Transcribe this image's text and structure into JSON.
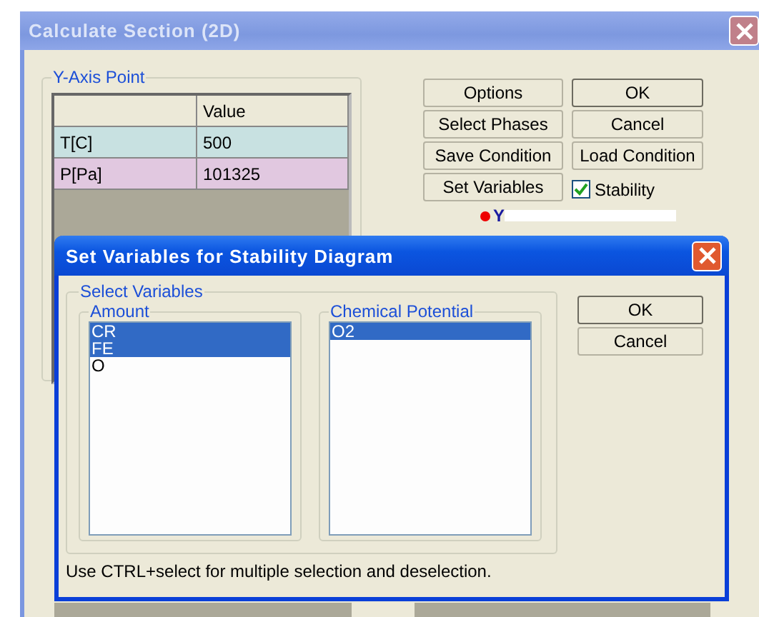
{
  "window": {
    "title": "Calculate Section (2D)"
  },
  "y_axis_point": {
    "title": "Y-Axis Point",
    "column_header": "Value",
    "rows": [
      {
        "name": "T[C]",
        "value": "500",
        "color": "#c8e1e1"
      },
      {
        "name": "P[Pa]",
        "value": "101325",
        "color": "#e1c8e0"
      }
    ]
  },
  "buttons": [
    {
      "label": "Options",
      "default": false
    },
    {
      "label": "OK",
      "default": true
    },
    {
      "label": "Select Phases",
      "default": false
    },
    {
      "label": "Cancel",
      "default": false
    },
    {
      "label": "Save Condition",
      "default": false
    },
    {
      "label": "Load Condition",
      "default": false
    },
    {
      "label": "Set Variables",
      "default": false
    }
  ],
  "stability": {
    "label": "Stability",
    "checked": true
  },
  "y_field": {
    "label": "Y"
  },
  "dialog": {
    "title": "Set Variables for Stability Diagram",
    "group": "Select Variables",
    "lists": [
      {
        "title": "Amount",
        "items": [
          {
            "label": "CR",
            "selected": true
          },
          {
            "label": "FE",
            "selected": true
          },
          {
            "label": "O",
            "selected": false
          }
        ]
      },
      {
        "title": "Chemical Potential",
        "items": [
          {
            "label": "O2",
            "selected": true
          }
        ]
      }
    ],
    "buttons": [
      {
        "label": "OK",
        "default": true
      },
      {
        "label": "Cancel",
        "default": false
      }
    ],
    "hint": "Use CTRL+select for multiple selection and deselection."
  }
}
